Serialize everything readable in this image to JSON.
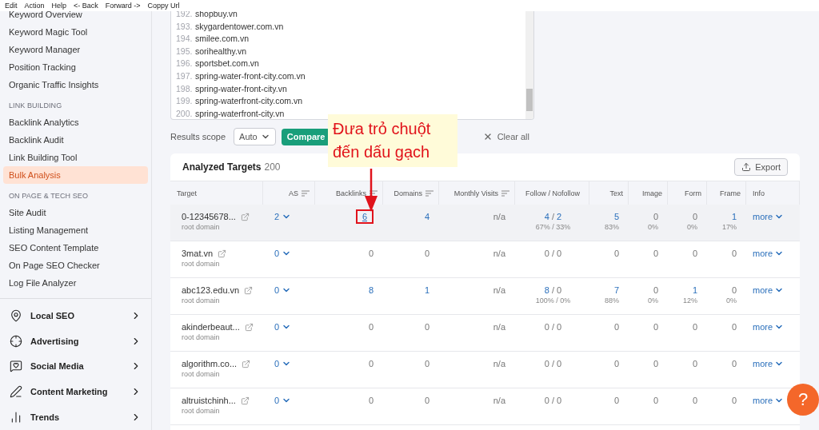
{
  "menu_bar": [
    "Edit",
    "Action",
    "Help",
    "<- Back",
    "Forward ->",
    "Coppy Url"
  ],
  "sidebar": {
    "sections": [
      {
        "items": [
          {
            "label": "Keyword Overview",
            "selected": false
          },
          {
            "label": "Keyword Magic Tool",
            "selected": false
          },
          {
            "label": "Keyword Manager",
            "selected": false
          },
          {
            "label": "Position Tracking",
            "selected": false
          },
          {
            "label": "Organic Traffic Insights",
            "selected": false
          }
        ]
      },
      {
        "heading": "LINK BUILDING",
        "items": [
          {
            "label": "Backlink Analytics",
            "selected": false
          },
          {
            "label": "Backlink Audit",
            "selected": false
          },
          {
            "label": "Link Building Tool",
            "selected": false
          },
          {
            "label": "Bulk Analysis",
            "selected": true
          }
        ]
      },
      {
        "heading": "ON PAGE & TECH SEO",
        "items": [
          {
            "label": "Site Audit",
            "selected": false
          },
          {
            "label": "Listing Management",
            "selected": false
          },
          {
            "label": "SEO Content Template",
            "selected": false
          },
          {
            "label": "On Page SEO Checker",
            "selected": false
          },
          {
            "label": "Log File Analyzer",
            "selected": false
          }
        ]
      }
    ],
    "categories": [
      "Local SEO",
      "Advertising",
      "Social Media",
      "Content Marketing",
      "Trends"
    ]
  },
  "target_list": [
    {
      "number": "192.",
      "domain": "shopbuy.vn"
    },
    {
      "number": "193.",
      "domain": "skygardentower.com.vn"
    },
    {
      "number": "194.",
      "domain": "smilee.com.vn"
    },
    {
      "number": "195.",
      "domain": "sorihealthy.vn"
    },
    {
      "number": "196.",
      "domain": "sportsbet.com.vn"
    },
    {
      "number": "197.",
      "domain": "spring-water-front-city.com.vn"
    },
    {
      "number": "198.",
      "domain": "spring-water-front-city.vn"
    },
    {
      "number": "199.",
      "domain": "spring-waterfront-city.com.vn"
    },
    {
      "number": "200.",
      "domain": "spring-waterfront-city.vn"
    }
  ],
  "controls": {
    "scope_label": "Results scope",
    "scope_value": "Auto",
    "compare": "Compare",
    "clear": "Clear all"
  },
  "table": {
    "follow_separator": "/",
    "title": "Analyzed Targets",
    "count": "200",
    "export": "Export",
    "columns": [
      {
        "label": "Target",
        "sortable": false
      },
      {
        "label": "AS",
        "sortable": true
      },
      {
        "label": "Backlinks",
        "sortable": true
      },
      {
        "label": "Domains",
        "sortable": true
      },
      {
        "label": "Monthly Visits",
        "sortable": true
      },
      {
        "label": "Follow / Nofollow",
        "sortable": false
      },
      {
        "label": "Text",
        "sortable": false
      },
      {
        "label": "Image",
        "sortable": false
      },
      {
        "label": "Form",
        "sortable": false
      },
      {
        "label": "Frame",
        "sortable": false
      },
      {
        "label": "Info",
        "sortable": false
      }
    ],
    "rows": [
      {
        "target": "0-12345678...",
        "type": "root domain",
        "as": "2",
        "hovered": true,
        "backlinks": {
          "value": "6",
          "linked": true,
          "highlighted": true
        },
        "domains": {
          "value": "4",
          "linked": true
        },
        "visits": "n/a",
        "follow": {
          "value": "4",
          "linked": true
        },
        "nofollow": {
          "value": "2",
          "linked": true
        },
        "follow_share": "67% / 33%",
        "text": {
          "value": "5",
          "linked": true,
          "share": "83%"
        },
        "image": {
          "value": "0",
          "linked": false,
          "share": "0%"
        },
        "form": {
          "value": "0",
          "linked": false,
          "share": "0%"
        },
        "frame": {
          "value": "1",
          "linked": true,
          "share": "17%"
        },
        "info": "more"
      },
      {
        "target": "3mat.vn",
        "type": "root domain",
        "as": "0",
        "hovered": false,
        "backlinks": {
          "value": "0",
          "linked": false,
          "highlighted": false
        },
        "domains": {
          "value": "0",
          "linked": false
        },
        "visits": "n/a",
        "follow": {
          "value": "0",
          "linked": false
        },
        "nofollow": {
          "value": "0",
          "linked": false
        },
        "text": {
          "value": "0",
          "linked": false
        },
        "image": {
          "value": "0",
          "linked": false
        },
        "form": {
          "value": "0",
          "linked": false
        },
        "frame": {
          "value": "0",
          "linked": false
        },
        "info": "more"
      },
      {
        "target": "abc123.edu.vn",
        "type": "root domain",
        "as": "0",
        "hovered": false,
        "backlinks": {
          "value": "8",
          "linked": true,
          "highlighted": false
        },
        "domains": {
          "value": "1",
          "linked": true
        },
        "visits": "n/a",
        "follow": {
          "value": "8",
          "linked": true
        },
        "nofollow": {
          "value": "0",
          "linked": false
        },
        "follow_share": "100% / 0%",
        "text": {
          "value": "7",
          "linked": true,
          "share": "88%"
        },
        "image": {
          "value": "0",
          "linked": false,
          "share": "0%"
        },
        "form": {
          "value": "1",
          "linked": true,
          "share": "12%"
        },
        "frame": {
          "value": "0",
          "linked": false,
          "share": "0%"
        },
        "info": "more"
      },
      {
        "target": "akinderbeaut...",
        "type": "root domain",
        "as": "0",
        "hovered": false,
        "backlinks": {
          "value": "0",
          "linked": false,
          "highlighted": false
        },
        "domains": {
          "value": "0",
          "linked": false
        },
        "visits": "n/a",
        "follow": {
          "value": "0",
          "linked": false
        },
        "nofollow": {
          "value": "0",
          "linked": false
        },
        "text": {
          "value": "0",
          "linked": false
        },
        "image": {
          "value": "0",
          "linked": false
        },
        "form": {
          "value": "0",
          "linked": false
        },
        "frame": {
          "value": "0",
          "linked": false
        },
        "info": "more"
      },
      {
        "target": "algorithm.co...",
        "type": "root domain",
        "as": "0",
        "hovered": false,
        "backlinks": {
          "value": "0",
          "linked": false,
          "highlighted": false
        },
        "domains": {
          "value": "0",
          "linked": false
        },
        "visits": "n/a",
        "follow": {
          "value": "0",
          "linked": false
        },
        "nofollow": {
          "value": "0",
          "linked": false
        },
        "text": {
          "value": "0",
          "linked": false
        },
        "image": {
          "value": "0",
          "linked": false
        },
        "form": {
          "value": "0",
          "linked": false
        },
        "frame": {
          "value": "0",
          "linked": false
        },
        "info": "more"
      },
      {
        "target": "altruistchinh...",
        "type": "root domain",
        "as": "0",
        "hovered": false,
        "backlinks": {
          "value": "0",
          "linked": false,
          "highlighted": false
        },
        "domains": {
          "value": "0",
          "linked": false
        },
        "visits": "n/a",
        "follow": {
          "value": "0",
          "linked": false
        },
        "nofollow": {
          "value": "0",
          "linked": false
        },
        "text": {
          "value": "0",
          "linked": false
        },
        "image": {
          "value": "0",
          "linked": false
        },
        "form": {
          "value": "0",
          "linked": false
        },
        "frame": {
          "value": "0",
          "linked": false
        },
        "info": "more"
      }
    ]
  },
  "annotation": {
    "text": "Đưa trỏ chuột đến dấu gạch"
  },
  "help_button": "?"
}
